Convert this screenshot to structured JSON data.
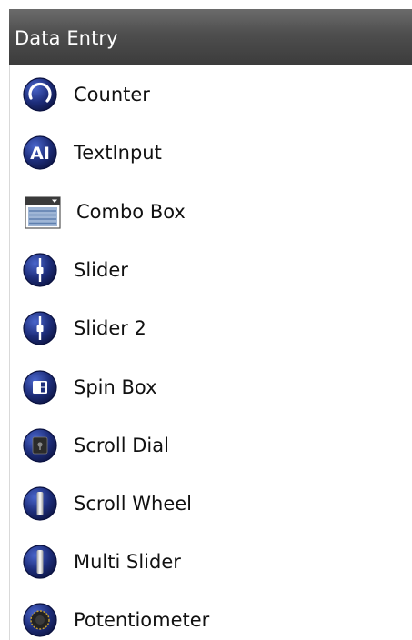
{
  "panel": {
    "title": "Data Entry",
    "items": [
      {
        "label": "Counter",
        "icon": "counter-icon"
      },
      {
        "label": "TextInput",
        "icon": "text-input-icon"
      },
      {
        "label": "Combo Box",
        "icon": "combo-box-icon"
      },
      {
        "label": "Slider",
        "icon": "slider-icon"
      },
      {
        "label": "Slider 2",
        "icon": "slider-icon"
      },
      {
        "label": "Spin Box",
        "icon": "spin-box-icon"
      },
      {
        "label": "Scroll Dial",
        "icon": "scroll-dial-icon"
      },
      {
        "label": "Scroll Wheel",
        "icon": "scroll-wheel-icon"
      },
      {
        "label": "Multi Slider",
        "icon": "multi-slider-icon"
      },
      {
        "label": "Potentiometer",
        "icon": "potentiometer-icon"
      }
    ],
    "icon_labels": {
      "text_input_glyph": "AI"
    }
  },
  "colors": {
    "header_top": "#6b6b6b",
    "header_bottom": "#3c3c3c",
    "icon_navy": "#1b2a6b",
    "icon_navy_light": "#3a54b8"
  }
}
